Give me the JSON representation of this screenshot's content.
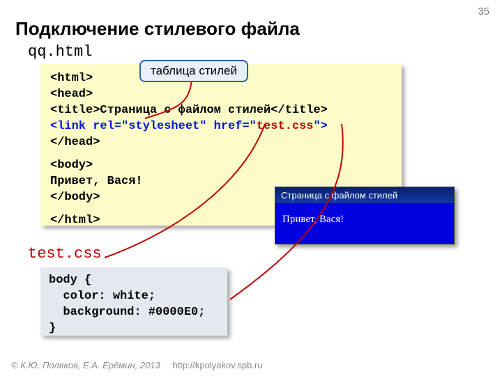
{
  "page_number": "35",
  "title": "Подключение стилевого файла",
  "file1": {
    "name": "qq.html"
  },
  "file2": {
    "name": "test.css"
  },
  "label": {
    "text": "таблица стилей"
  },
  "code1": {
    "l1": "<html>",
    "l2": "<head>",
    "l3a": "<title>",
    "l3b": "Страница с файлом стилей",
    "l3c": "</title>",
    "l4a": "<link rel=\"stylesheet\" href=\"",
    "l4b": "test.css",
    "l4c": "\">",
    "l5": "</head>",
    "l6": "<body>",
    "l7": "Привет, Вася!",
    "l8": "</body>",
    "l9": "</html>"
  },
  "code2": {
    "l1": "body {",
    "l2": "  color: white;",
    "l3": "  background: #0000E0;",
    "l4": "}"
  },
  "preview": {
    "title": "Страница с файлом стилей",
    "body": "Привет, Вася!"
  },
  "footer": {
    "copyright": "© К.Ю. Поляков, Е.А. Ерёмин, 2013",
    "url": "http://kpolyakov.spb.ru"
  }
}
